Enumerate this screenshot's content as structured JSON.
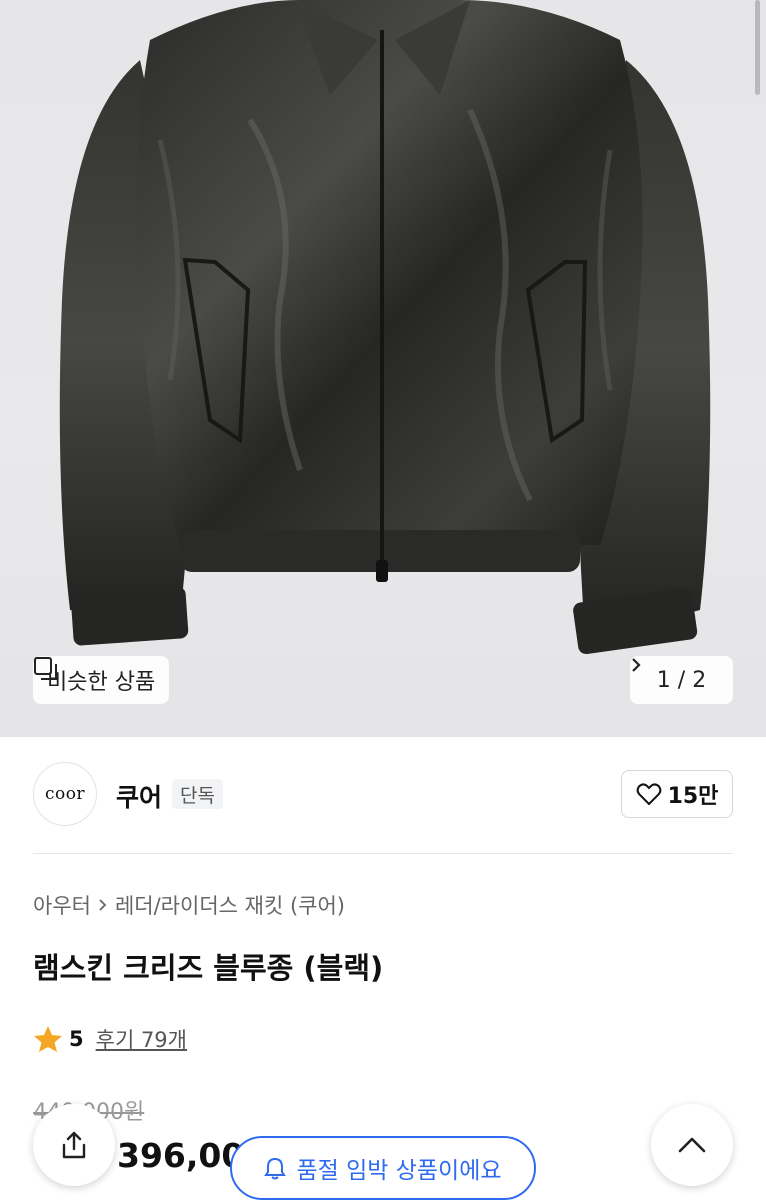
{
  "gallery": {
    "similar_label": "비슷한 상품",
    "pager_current": "1",
    "pager_sep": "/",
    "pager_total": "2"
  },
  "brand": {
    "logo_text": "coor",
    "name": "쿠어",
    "tag": "단독",
    "likes": "15만"
  },
  "product": {
    "breadcrumb": [
      "아우터",
      "레더/라이더스 재킷 (쿠어)"
    ],
    "title": "램스킨 크리즈 블루종 (블랙)",
    "rating": "5",
    "review_text": "후기 79개",
    "original_price": "440,000원",
    "price": "396,00"
  },
  "toast": {
    "text": "품절 임박 상품이에요"
  },
  "colors": {
    "accent": "#2f6bf0",
    "star": "#f5a623"
  }
}
